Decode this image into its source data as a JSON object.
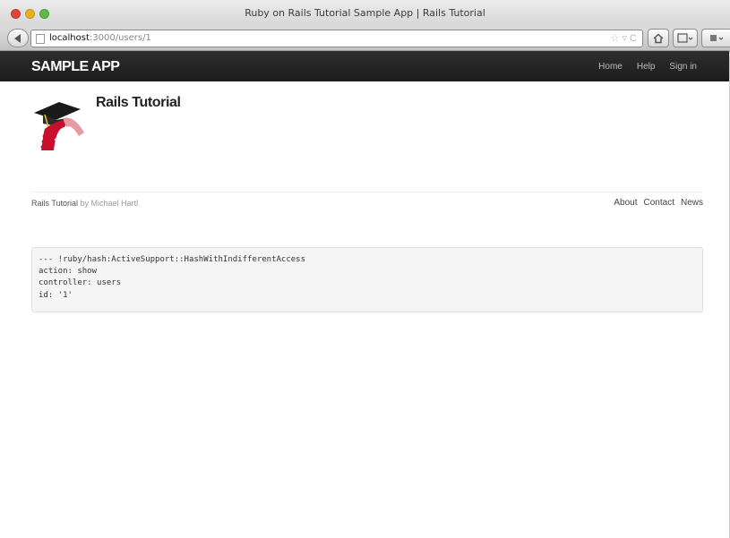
{
  "window": {
    "title": "Ruby on Rails Tutorial Sample App | Rails Tutorial"
  },
  "browser": {
    "url_host": "localhost",
    "url_path": ":3000/users/1",
    "url_right_glyphs": "☆ ▿ C"
  },
  "navbar": {
    "brand": "SAMPLE APP",
    "links": [
      "Home",
      "Help",
      "Sign in"
    ]
  },
  "main": {
    "title": "Rails Tutorial"
  },
  "footer": {
    "brand": "Rails Tutorial",
    "by_text": "by Michael Hartl",
    "links": [
      "About",
      "Contact",
      "News"
    ]
  },
  "debug": {
    "lines": [
      "--- !ruby/hash:ActiveSupport::HashWithIndifferentAccess",
      "action: show",
      "controller: users",
      "id: '1'"
    ]
  },
  "colors": {
    "navbar_bg": "#222222",
    "logo_red": "#c8102e",
    "debug_bg": "#f5f5f5"
  }
}
